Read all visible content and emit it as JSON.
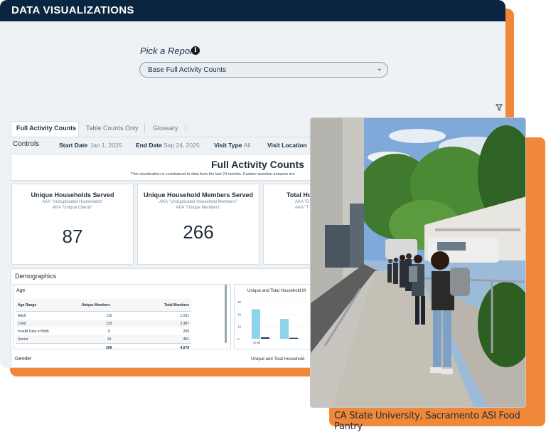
{
  "app": {
    "title": "DATA VISUALIZATIONS"
  },
  "report_picker": {
    "label": "Pick a Report",
    "info_icon": "info-icon",
    "selected": "Base Full Activity Counts"
  },
  "tabs": [
    {
      "label": "Full Activity Counts",
      "active": true
    },
    {
      "label": "Table Counts Only",
      "active": false
    },
    {
      "label": "Glossary",
      "active": false
    }
  ],
  "controls": {
    "label": "Controls",
    "start_date_key": "Start Date",
    "start_date_value": "Jan 1, 2025",
    "end_date_key": "End Date",
    "end_date_value": "Sep 24, 2025",
    "visit_type_key": "Visit Type",
    "visit_type_value": "All",
    "visit_location_key": "Visit Location"
  },
  "report": {
    "title": "Full Activity Counts",
    "subtitle": "This visualization is constrained to data from the last 24 months. Custom question answers are"
  },
  "stats": [
    {
      "title": "Unique Households Served",
      "aka1": "AKA \"Unduplicated Households\"",
      "aka2": "AKA \"Unique Clients\"",
      "value": "87"
    },
    {
      "title": "Unique Household Members Served",
      "aka1": "AKA \"Unduplicated Household Members\"",
      "aka2": "AKA \"Unique Members\"",
      "value": "266"
    },
    {
      "title": "Total Ho",
      "aka1": "AKA \"D",
      "aka2": "AKA \"T"
    }
  ],
  "demographics": {
    "label": "Demographics",
    "age": {
      "label": "Age",
      "columns": [
        "Age Range",
        "Unique Members",
        "Total Members"
      ],
      "rows": [
        [
          "Adult",
          "115",
          "1,531"
        ],
        [
          "Child",
          "123",
          "2,387"
        ],
        [
          "Invalid Date of Birth",
          "9",
          "209"
        ],
        [
          "Senior",
          "19",
          "451"
        ]
      ],
      "totals": [
        "",
        "266",
        "4,578"
      ]
    },
    "gender_label": "Gender",
    "age_chart_title": "Unique and Total Household M",
    "gender_chart_title": "Unique and Total Household"
  },
  "chart_data": {
    "type": "bar",
    "title": "Unique and Total Household M",
    "categories": [
      "Child",
      ""
    ],
    "series": [
      {
        "values": [
          2400,
          1600
        ],
        "color": "#8dd3ea"
      },
      {
        "values": [
          120,
          80
        ],
        "color": "#1f3a5c"
      }
    ],
    "ytick_labels": [
      "3K",
      "2K",
      "1K",
      "0"
    ],
    "ylim": [
      0,
      3000
    ]
  },
  "photo": {
    "caption": "CA State University, Sacramento ASI Food Pantry"
  },
  "colors": {
    "navy": "#0a2540",
    "orange": "#f0883a",
    "bar_light": "#8dd3ea",
    "bar_dark": "#1f3a5c"
  }
}
